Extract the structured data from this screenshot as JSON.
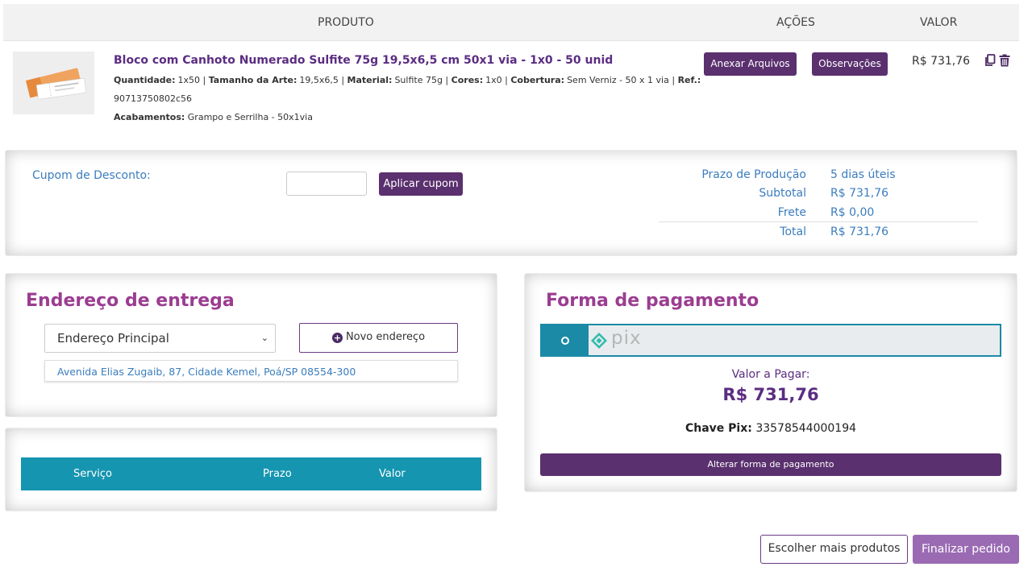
{
  "table_header": {
    "product": "PRODUTO",
    "actions": "AÇÕES",
    "value": "VALOR"
  },
  "product": {
    "title": "Bloco com Canhoto Numerado Sulfite 75g 19,5x6,5 cm 50x1 via - 1x0 - 50 unid",
    "spec_line1": [
      {
        "k": "Quantidade:",
        "v": "1x50"
      },
      {
        "k": "Tamanho da Arte:",
        "v": "19,5x6,5"
      },
      {
        "k": "Material:",
        "v": "Sulfite 75g"
      },
      {
        "k": "Cores:",
        "v": "1x0"
      },
      {
        "k": "Cobertura:",
        "v": "Sem Verniz - 50 x 1 via"
      },
      {
        "k": "Ref.:",
        "v": ""
      }
    ],
    "ref_value": "90713750802c56",
    "finishing_label": "Acabamentos:",
    "finishing_value": "Grampo e Serrilha - 50x1via",
    "attach_label": "Anexar Arquivos",
    "notes_label": "Observações",
    "price": "R$ 731,76",
    "copy_icon": "copy-icon",
    "delete_icon": "trash-icon"
  },
  "coupon": {
    "label": "Cupom de Desconto:",
    "input_value": "",
    "apply_label": "Aplicar cupom"
  },
  "summary": {
    "rows": [
      {
        "label": "Prazo de Produção",
        "value": "5 dias úteis"
      },
      {
        "label": "Subtotal",
        "value": "R$ 731,76"
      },
      {
        "label": "Frete",
        "value": "R$ 0,00"
      },
      {
        "label": "Total",
        "value": "R$ 731,76"
      }
    ]
  },
  "delivery": {
    "title": "Endereço de entrega",
    "selected": "Endereço Principal",
    "new_label": "Novo endereço",
    "address": "Avenida Elias Zugaib, 87, Cidade Kemel, Poá/SP 08554-300"
  },
  "shipping": {
    "columns": [
      "Serviço",
      "Prazo",
      "Valor"
    ]
  },
  "payment": {
    "title": "Forma de pagamento",
    "method_logo_text": "pix",
    "amount_label": "Valor a Pagar:",
    "amount": "R$ 731,76",
    "pix_key_label": "Chave Pix:",
    "pix_key": "33578544000194",
    "change_label": "Alterar forma de pagamento"
  },
  "footer": {
    "more_label": "Escolher mais produtos",
    "finish_label": "Finalizar pedido"
  },
  "colors": {
    "brand_purple": "#5a306e",
    "title_magenta": "#9b3d91",
    "link_blue": "#3a7dbd",
    "teal": "#1695b0",
    "pix_green": "#32bcad"
  }
}
